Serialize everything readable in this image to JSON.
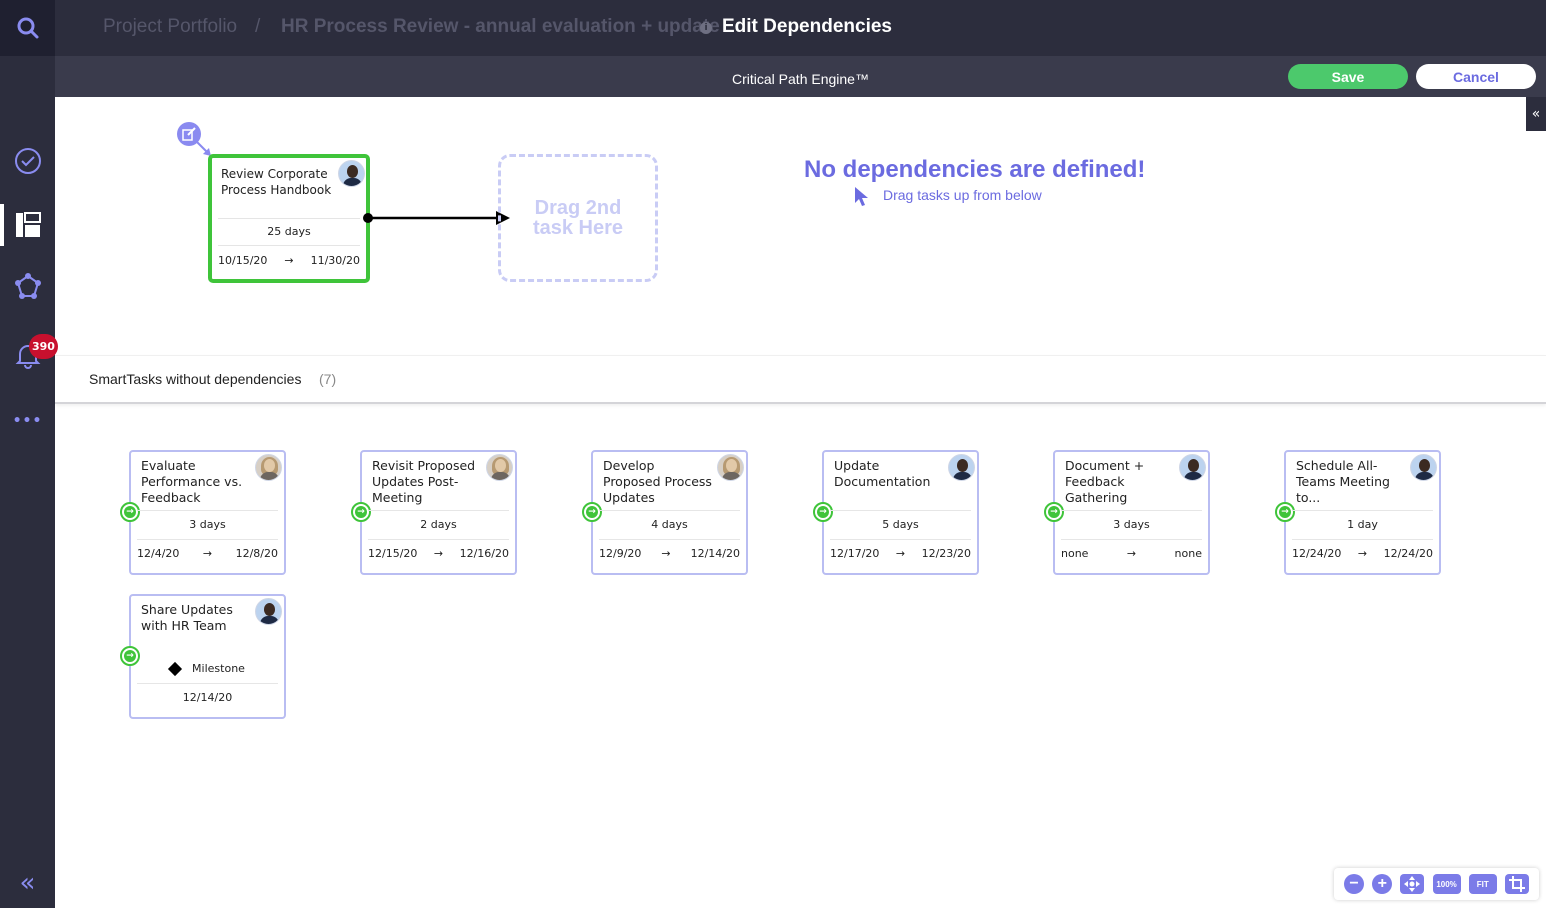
{
  "breadcrumb": {
    "portfolio": "Project Portfolio",
    "separator": "/",
    "project": "HR Process Review  -  annual evaluation + update",
    "current": "Edit Dependencies"
  },
  "toolbar": {
    "engine_title": "Critical Path Engine™",
    "save_label": "Save",
    "cancel_label": "Cancel"
  },
  "sidebar": {
    "notification_count": "390",
    "collapse_glyph": "«",
    "more_glyph": "•••"
  },
  "colors": {
    "accent": "#6b6be0",
    "success": "#3fc43a",
    "sidebar": "#2c2d3d",
    "badge": "#c8102e"
  },
  "selected_task": {
    "title": "Review Corporate Process Handbook",
    "duration": "25 days",
    "start": "10/15/20",
    "arrow": "→",
    "end": "11/30/20"
  },
  "drop_zone": {
    "label_line1": "Drag 2nd",
    "label_line2": "task Here"
  },
  "empty_state": {
    "title": "No dependencies are defined!",
    "subtitle": "Drag tasks up from below"
  },
  "section": {
    "label": "SmartTasks without dependencies",
    "count": "(7)"
  },
  "tasks": [
    {
      "title": "Evaluate Performance vs. Feedback",
      "duration": "3 days",
      "start": "12/4/20",
      "arrow": "→",
      "end": "12/8/20"
    },
    {
      "title": "Revisit Proposed Updates Post-Meeting",
      "duration": "2 days",
      "start": "12/15/20",
      "arrow": "→",
      "end": "12/16/20"
    },
    {
      "title": "Develop Proposed Process Updates",
      "duration": "4 days",
      "start": "12/9/20",
      "arrow": "→",
      "end": "12/14/20"
    },
    {
      "title": "Update Documentation",
      "duration": "5 days",
      "start": "12/17/20",
      "arrow": "→",
      "end": "12/23/20"
    },
    {
      "title": "Document + Feedback Gathering",
      "duration": "3 days",
      "start": "none",
      "arrow": "→",
      "end": "none"
    },
    {
      "title": "Schedule All-Teams Meeting to...",
      "duration": "1 day",
      "start": "12/24/20",
      "arrow": "→",
      "end": "12/24/20"
    },
    {
      "title": "Share Updates with HR Team",
      "milestone_label": "Milestone",
      "date": "12/14/20"
    }
  ],
  "zoom": {
    "zoom_out": "−",
    "zoom_in": "+",
    "pct_label": "100%",
    "fit_label": "FIT"
  }
}
